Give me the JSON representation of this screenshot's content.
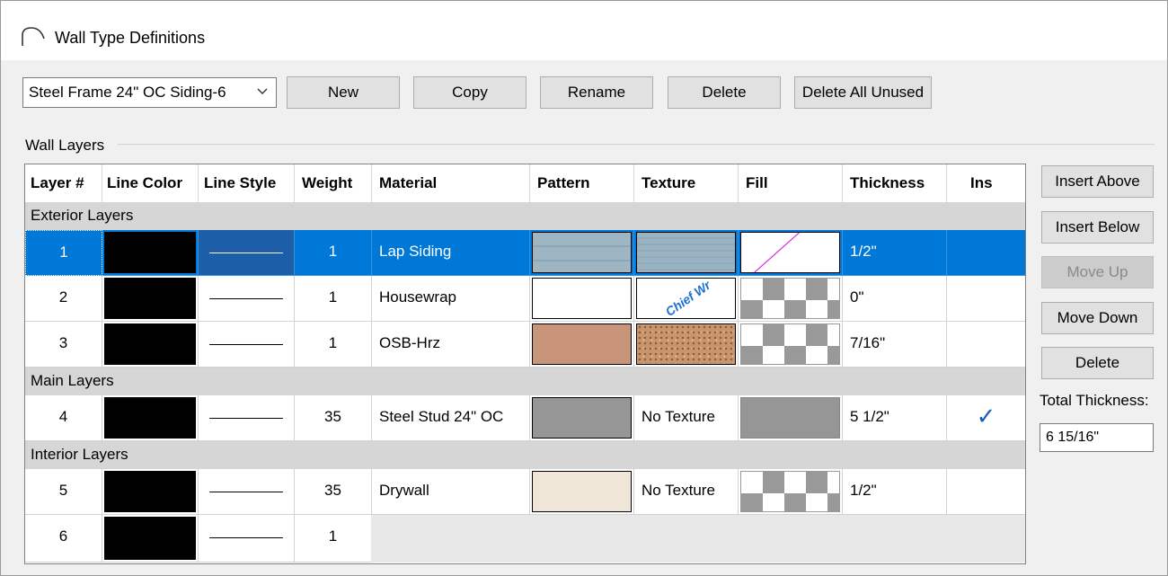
{
  "window": {
    "title": "Wall Type Definitions"
  },
  "toolbar": {
    "wall_type_selected": "Steel Frame 24\" OC Siding-6",
    "new_label": "New",
    "copy_label": "Copy",
    "rename_label": "Rename",
    "delete_label": "Delete",
    "delete_all_unused_label": "Delete All Unused"
  },
  "wall_layers": {
    "group_label": "Wall Layers",
    "columns": [
      "Layer #",
      "Line Color",
      "Line Style",
      "Weight",
      "Material",
      "Pattern",
      "Texture",
      "Fill",
      "Thickness",
      "Ins"
    ],
    "sections": [
      "Exterior Layers",
      "Main Layers",
      "Interior Layers"
    ],
    "rows": [
      {
        "layer": "1",
        "weight": "1",
        "material": "Lap Siding",
        "texture": "",
        "thickness": "1/2\"",
        "ins": ""
      },
      {
        "layer": "2",
        "weight": "1",
        "material": "Housewrap",
        "texture": "",
        "thickness": "0\"",
        "ins": ""
      },
      {
        "layer": "3",
        "weight": "1",
        "material": "OSB-Hrz",
        "texture": "",
        "thickness": "7/16\"",
        "ins": ""
      },
      {
        "layer": "4",
        "weight": "35",
        "material": "Steel Stud 24\" OC",
        "texture": "No Texture",
        "thickness": "5 1/2\"",
        "ins": "✓"
      },
      {
        "layer": "5",
        "weight": "35",
        "material": "Drywall",
        "texture": "No Texture",
        "thickness": "1/2\"",
        "ins": ""
      },
      {
        "layer": "6",
        "weight": "1",
        "material": "",
        "texture": "",
        "thickness": "",
        "ins": ""
      }
    ],
    "texture_watermark": "Chief Wr"
  },
  "side_buttons": {
    "insert_above": "Insert Above",
    "insert_below": "Insert Below",
    "move_up": "Move Up",
    "move_down": "Move Down",
    "delete": "Delete"
  },
  "total_thickness": {
    "label": "Total Thickness:",
    "value": "6 15/16\""
  },
  "colors": {
    "selection": "#0078d7",
    "section_bg": "#d6d6d6",
    "check": "#1a5fb4"
  }
}
